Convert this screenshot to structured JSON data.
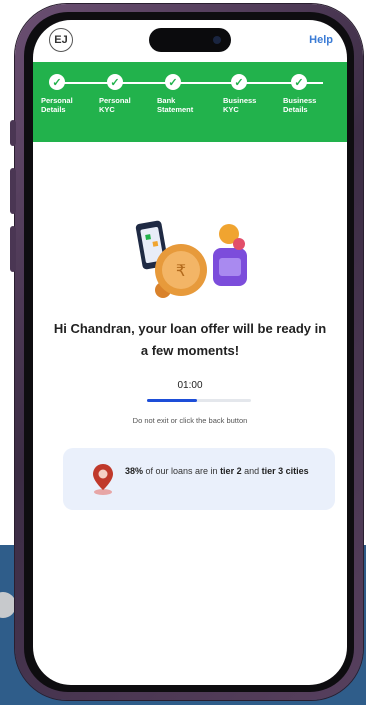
{
  "header": {
    "logo_text": "EJ",
    "help_label": "Help"
  },
  "stepper": {
    "steps": [
      {
        "label": "Personal\nDetails",
        "status": "completed"
      },
      {
        "label": "Personal\nKYC",
        "status": "completed"
      },
      {
        "label": "Bank\nStatement",
        "status": "completed"
      },
      {
        "label": "Business\nKYC",
        "status": "completed"
      },
      {
        "label": "Business\nDetails",
        "status": "completed"
      }
    ],
    "check_glyph": "✓",
    "accent_color": "#22b24c"
  },
  "main": {
    "headline": "Hi Chandran, your loan offer will be ready in a few moments!",
    "timer": "01:00",
    "progress_fraction": 0.48,
    "note": "Do not exit or click the back button",
    "illustration_icon": "loan-coins-phone-icon"
  },
  "info_card": {
    "percent": "38%",
    "text_part1": " of our loans are in ",
    "tier_highlight": "tier 2",
    "text_part2": " and ",
    "tier3_highlight": "tier 3 cities",
    "icon": "location-pin-icon"
  }
}
